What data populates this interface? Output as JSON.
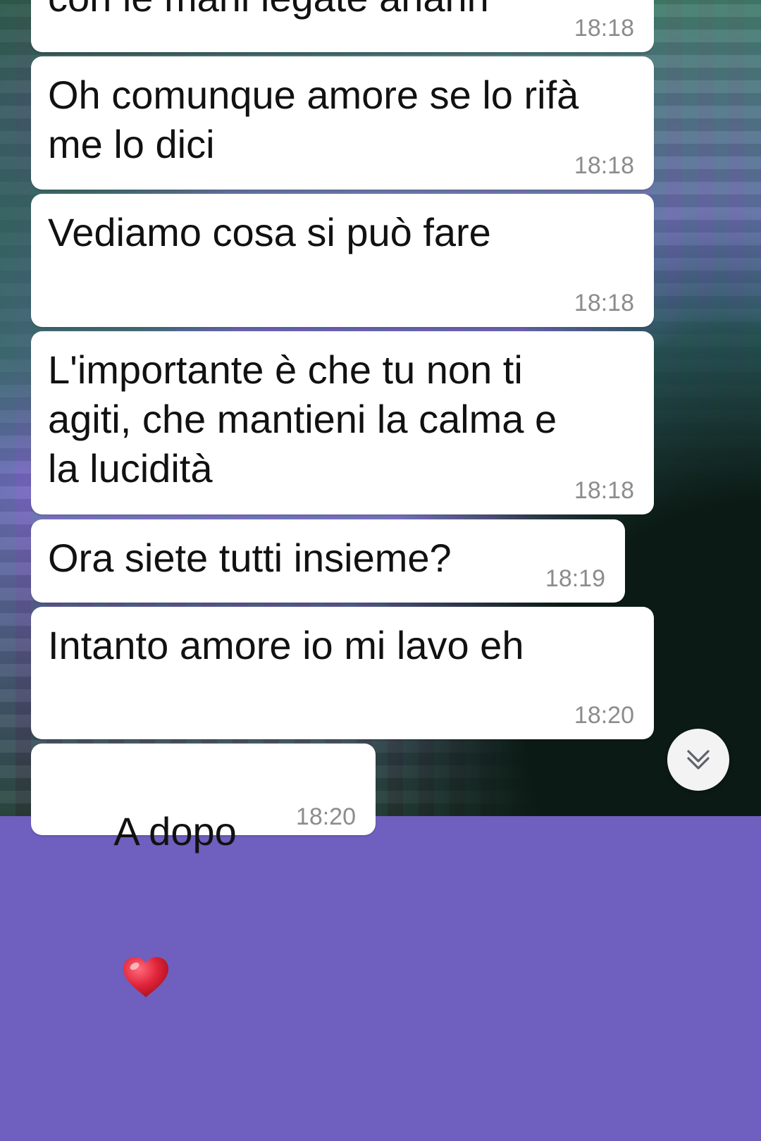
{
  "chat": {
    "messages": [
      {
        "text": "con le mani legate ahahh",
        "time": "18:18"
      },
      {
        "text": "Oh comunque amore se lo rifà\nme lo dici",
        "time": "18:18"
      },
      {
        "text": "Vediamo cosa si può fare",
        "time": "18:18"
      },
      {
        "text": "L'importante è che tu non ti\nagiti, che mantieni la calma e\nla lucidità",
        "time": "18:18"
      },
      {
        "text": "Ora siete tutti insieme?",
        "time": "18:19"
      },
      {
        "text": "Intanto amore io mi lavo eh",
        "time": "18:20"
      },
      {
        "text": "A dopo",
        "emoji": "heart-icon",
        "time": "18:20"
      }
    ]
  },
  "scroll_button": {
    "icon": "double-chevron-down-icon"
  },
  "colors": {
    "bubble": "#ffffff",
    "text": "#111111",
    "timestamp": "#8c8c8c",
    "heart": "#e0243a"
  }
}
